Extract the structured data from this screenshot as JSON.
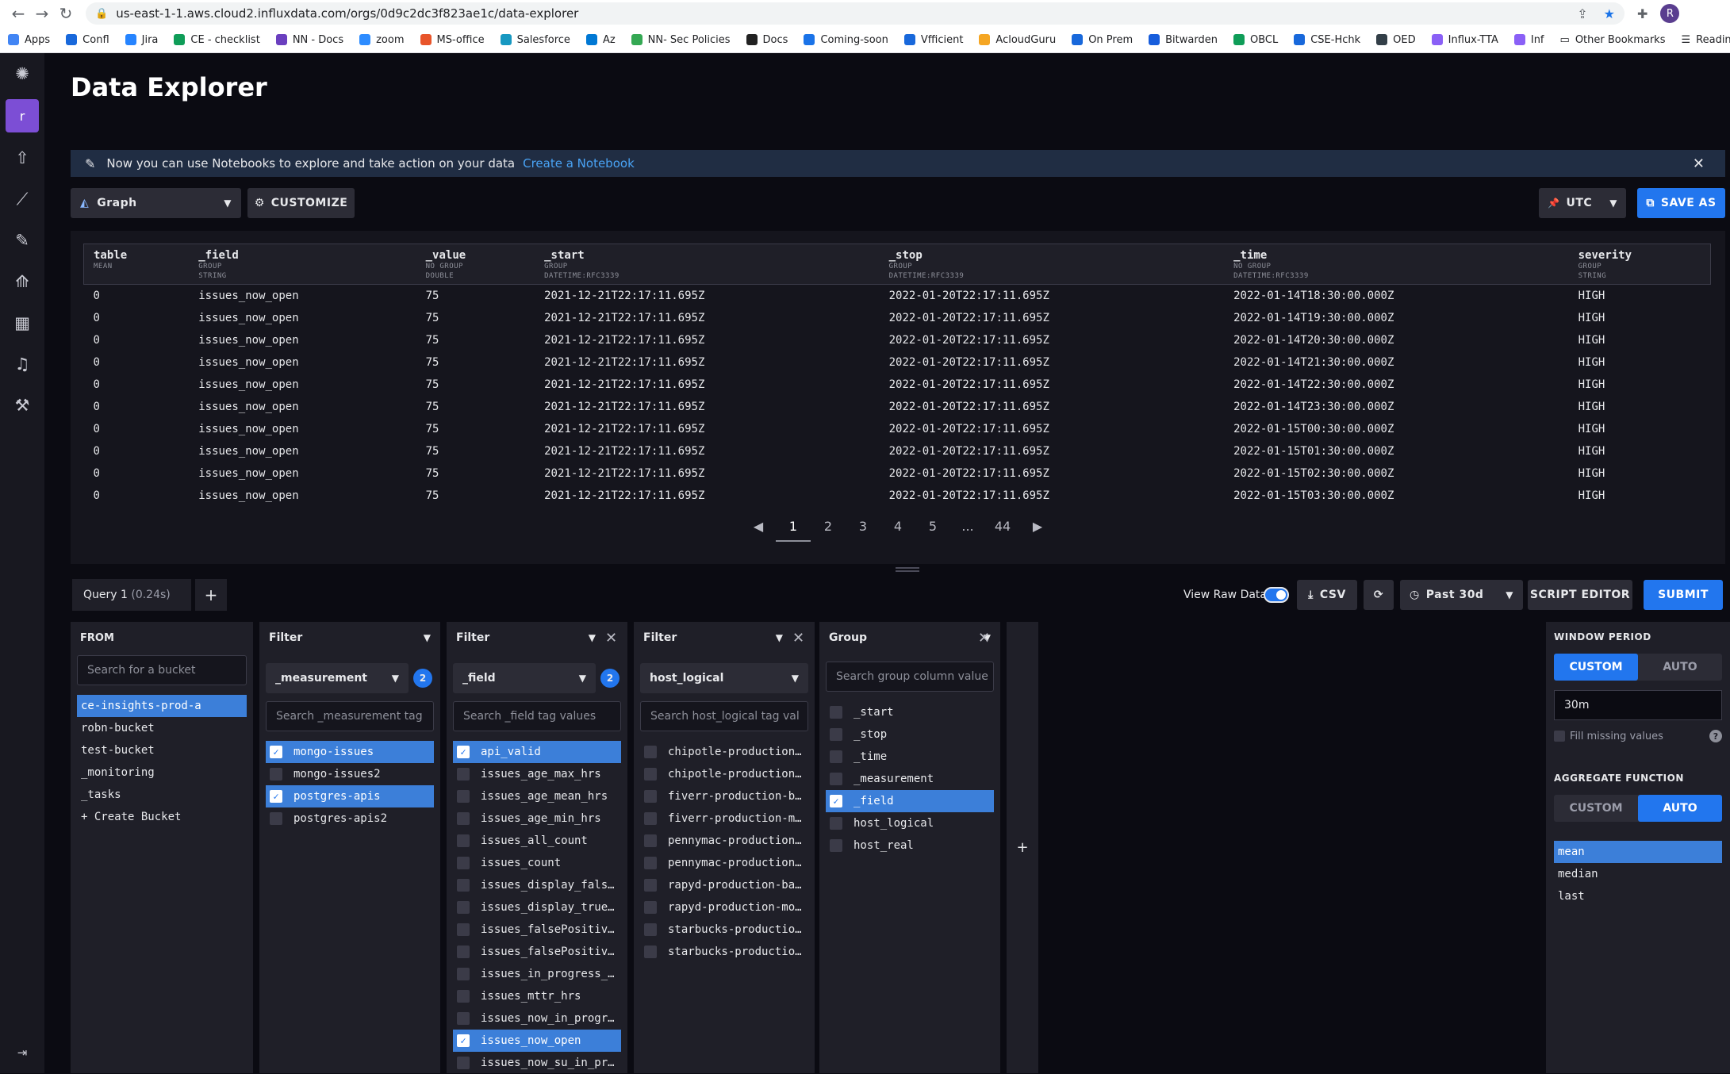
{
  "browser": {
    "url": "us-east-1-1.aws.cloud2.influxdata.com/orgs/0d9c2dc3f823ae1c/data-explorer",
    "profile_initial": "R",
    "bookmarks": [
      {
        "label": "Apps",
        "color": "#4285f4"
      },
      {
        "label": "Confl",
        "color": "#1868db"
      },
      {
        "label": "Jira",
        "color": "#2684ff"
      },
      {
        "label": "CE - checklist",
        "color": "#0f9d58"
      },
      {
        "label": "NN - Docs",
        "color": "#6a3fbf"
      },
      {
        "label": "zoom",
        "color": "#2d8cff"
      },
      {
        "label": "MS-office",
        "color": "#e8542a"
      },
      {
        "label": "Salesforce",
        "color": "#1798c1"
      },
      {
        "label": "Az",
        "color": "#0078d4"
      },
      {
        "label": "NN- Sec Policies",
        "color": "#34a853"
      },
      {
        "label": "Docs",
        "color": "#222222"
      },
      {
        "label": "Coming-soon",
        "color": "#1a73e8"
      },
      {
        "label": "Vfficient",
        "color": "#1868db"
      },
      {
        "label": "AcloudGuru",
        "color": "#f5a623"
      },
      {
        "label": "On Prem",
        "color": "#1868db"
      },
      {
        "label": "Bitwarden",
        "color": "#175ddc"
      },
      {
        "label": "OBCL",
        "color": "#0f9d58"
      },
      {
        "label": "CSE-Hchk",
        "color": "#1868db"
      },
      {
        "label": "OED",
        "color": "#333f48"
      },
      {
        "label": "Influx-TTA",
        "color": "#8a60f6"
      },
      {
        "label": "Inf",
        "color": "#8a60f6"
      }
    ],
    "other_bookmarks": "Other Bookmarks",
    "reading_list": "Reading Li"
  },
  "leftnav": {
    "org_initial": "r",
    "icons": [
      "influx-logo-icon",
      "upload-icon",
      "data-explorer-icon",
      "notebook-icon",
      "dashboards-icon",
      "tasks-icon",
      "alerts-icon",
      "settings-icon"
    ]
  },
  "page": {
    "title": "Data Explorer",
    "notice": "Now you can use Notebooks to explore and take action on your data",
    "notice_link": "Create a Notebook",
    "view_type": "Graph",
    "customize": "CUSTOMIZE",
    "timezone": "UTC",
    "save_as": "SAVE AS"
  },
  "table": {
    "columns": [
      {
        "name": "table",
        "sub1": "MEAN",
        "sub2": ""
      },
      {
        "name": "_field",
        "sub1": "GROUP",
        "sub2": "STRING"
      },
      {
        "name": "_value",
        "sub1": "NO GROUP",
        "sub2": "DOUBLE"
      },
      {
        "name": "_start",
        "sub1": "GROUP",
        "sub2": "DATETIME:RFC3339"
      },
      {
        "name": "_stop",
        "sub1": "GROUP",
        "sub2": "DATETIME:RFC3339"
      },
      {
        "name": "_time",
        "sub1": "NO GROUP",
        "sub2": "DATETIME:RFC3339"
      },
      {
        "name": "severity",
        "sub1": "GROUP",
        "sub2": "STRING"
      }
    ],
    "rows": [
      [
        "0",
        "issues_now_open",
        "75",
        "2021-12-21T22:17:11.695Z",
        "2022-01-20T22:17:11.695Z",
        "2022-01-14T18:30:00.000Z",
        "HIGH"
      ],
      [
        "0",
        "issues_now_open",
        "75",
        "2021-12-21T22:17:11.695Z",
        "2022-01-20T22:17:11.695Z",
        "2022-01-14T19:30:00.000Z",
        "HIGH"
      ],
      [
        "0",
        "issues_now_open",
        "75",
        "2021-12-21T22:17:11.695Z",
        "2022-01-20T22:17:11.695Z",
        "2022-01-14T20:30:00.000Z",
        "HIGH"
      ],
      [
        "0",
        "issues_now_open",
        "75",
        "2021-12-21T22:17:11.695Z",
        "2022-01-20T22:17:11.695Z",
        "2022-01-14T21:30:00.000Z",
        "HIGH"
      ],
      [
        "0",
        "issues_now_open",
        "75",
        "2021-12-21T22:17:11.695Z",
        "2022-01-20T22:17:11.695Z",
        "2022-01-14T22:30:00.000Z",
        "HIGH"
      ],
      [
        "0",
        "issues_now_open",
        "75",
        "2021-12-21T22:17:11.695Z",
        "2022-01-20T22:17:11.695Z",
        "2022-01-14T23:30:00.000Z",
        "HIGH"
      ],
      [
        "0",
        "issues_now_open",
        "75",
        "2021-12-21T22:17:11.695Z",
        "2022-01-20T22:17:11.695Z",
        "2022-01-15T00:30:00.000Z",
        "HIGH"
      ],
      [
        "0",
        "issues_now_open",
        "75",
        "2021-12-21T22:17:11.695Z",
        "2022-01-20T22:17:11.695Z",
        "2022-01-15T01:30:00.000Z",
        "HIGH"
      ],
      [
        "0",
        "issues_now_open",
        "75",
        "2021-12-21T22:17:11.695Z",
        "2022-01-20T22:17:11.695Z",
        "2022-01-15T02:30:00.000Z",
        "HIGH"
      ],
      [
        "0",
        "issues_now_open",
        "75",
        "2021-12-21T22:17:11.695Z",
        "2022-01-20T22:17:11.695Z",
        "2022-01-15T03:30:00.000Z",
        "HIGH"
      ]
    ],
    "pages": [
      "1",
      "2",
      "3",
      "4",
      "5",
      "...",
      "44"
    ],
    "current_page": "1"
  },
  "query": {
    "tab_label": "Query 1",
    "tab_time": "(0.24s)",
    "view_raw": "View Raw Data",
    "csv": "CSV",
    "time_range": "Past 30d",
    "script_editor": "SCRIPT EDITOR",
    "submit": "SUBMIT"
  },
  "from": {
    "header": "FROM",
    "search_placeholder": "Search for a bucket",
    "buckets": [
      {
        "label": "ce-insights-prod-a",
        "selected": true
      },
      {
        "label": "robn-bucket",
        "selected": false
      },
      {
        "label": "test-bucket",
        "selected": false
      },
      {
        "label": "_monitoring",
        "selected": false
      },
      {
        "label": "_tasks",
        "selected": false
      },
      {
        "label": "+ Create Bucket",
        "selected": false
      }
    ]
  },
  "filters": [
    {
      "header": "Filter",
      "key": "_measurement",
      "count": "2",
      "search_placeholder": "Search _measurement tag",
      "items": [
        {
          "label": "mongo-issues",
          "selected": true
        },
        {
          "label": "mongo-issues2",
          "selected": false
        },
        {
          "label": "postgres-apis",
          "selected": true
        },
        {
          "label": "postgres-apis2",
          "selected": false
        }
      ]
    },
    {
      "header": "Filter",
      "key": "_field",
      "count": "2",
      "search_placeholder": "Search _field tag values",
      "items": [
        {
          "label": "api_valid",
          "selected": true
        },
        {
          "label": "issues_age_max_hrs",
          "selected": false
        },
        {
          "label": "issues_age_mean_hrs",
          "selected": false
        },
        {
          "label": "issues_age_min_hrs",
          "selected": false
        },
        {
          "label": "issues_all_count",
          "selected": false
        },
        {
          "label": "issues_count",
          "selected": false
        },
        {
          "label": "issues_display_fals…",
          "selected": false
        },
        {
          "label": "issues_display_true…",
          "selected": false
        },
        {
          "label": "issues_falsePositiv…",
          "selected": false
        },
        {
          "label": "issues_falsePositiv…",
          "selected": false
        },
        {
          "label": "issues_in_progress_…",
          "selected": false
        },
        {
          "label": "issues_mttr_hrs",
          "selected": false
        },
        {
          "label": "issues_now_in_progr…",
          "selected": false
        },
        {
          "label": "issues_now_open",
          "selected": true
        },
        {
          "label": "issues_now_su_in_pr…",
          "selected": false
        }
      ]
    },
    {
      "header": "Filter",
      "key": "host_logical",
      "count": "",
      "search_placeholder": "Search host_logical tag val",
      "items": [
        {
          "label": "chipotle-production…",
          "selected": false
        },
        {
          "label": "chipotle-production…",
          "selected": false
        },
        {
          "label": "fiverr-production-b…",
          "selected": false
        },
        {
          "label": "fiverr-production-m…",
          "selected": false
        },
        {
          "label": "pennymac-production…",
          "selected": false
        },
        {
          "label": "pennymac-production…",
          "selected": false
        },
        {
          "label": "rapyd-production-ba…",
          "selected": false
        },
        {
          "label": "rapyd-production-mo…",
          "selected": false
        },
        {
          "label": "starbucks-productio…",
          "selected": false
        },
        {
          "label": "starbucks-productio…",
          "selected": false
        }
      ]
    }
  ],
  "group": {
    "header": "Group",
    "search_placeholder": "Search group column value",
    "items": [
      {
        "label": "_start",
        "selected": false
      },
      {
        "label": "_stop",
        "selected": false
      },
      {
        "label": "_time",
        "selected": false
      },
      {
        "label": "_measurement",
        "selected": false
      },
      {
        "label": "_field",
        "selected": true
      },
      {
        "label": "host_logical",
        "selected": false
      },
      {
        "label": "host_real",
        "selected": false
      }
    ]
  },
  "aggregate": {
    "window_title": "WINDOW PERIOD",
    "custom": "CUSTOM",
    "auto": "AUTO",
    "period": "30m",
    "fill_missing": "Fill missing values",
    "fn_title": "AGGREGATE FUNCTION",
    "functions": [
      {
        "label": "mean",
        "selected": true
      },
      {
        "label": "median",
        "selected": false
      },
      {
        "label": "last",
        "selected": false
      }
    ]
  }
}
